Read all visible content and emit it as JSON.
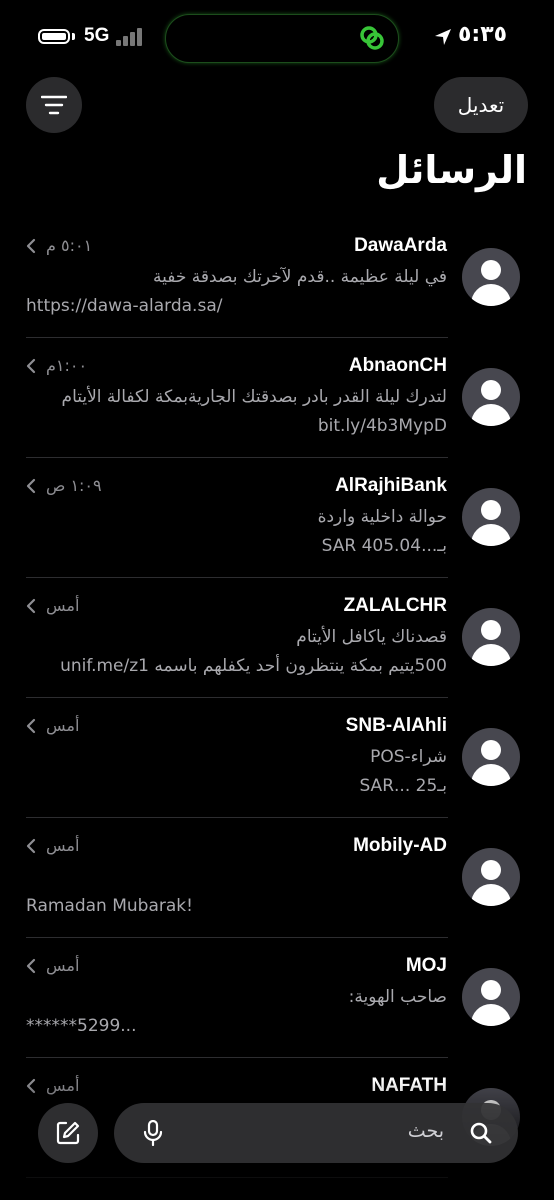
{
  "status_bar": {
    "network": "5G",
    "time": "٥:٣٥",
    "battery_level": 1.0,
    "signal_bars_active": 0
  },
  "header": {
    "edit_label": "تعديل",
    "title": "الرسائل",
    "filter_icon": "filter-lines-icon"
  },
  "messages": [
    {
      "sender": "DawaArda",
      "time": "٥:٠١ م",
      "line1": "في ليلة عظيمة ..قدم لآخرتك بصدقة خفية",
      "line2": "https://dawa-alarda.sa/"
    },
    {
      "sender": "AbnaonCH",
      "time": "١:٠٠م",
      "line1": "لتدرك ليلة القدر بادر بصدقتك الجاريةبمكة لكفالة الأيتام",
      "line2": "bit.ly/4b3MypD"
    },
    {
      "sender": "AlRajhiBank",
      "time": "١:٠٩ ص",
      "line1": "حوالة داخلية واردة",
      "line2": "بـ...SAR 405.04"
    },
    {
      "sender": "ZALALCHR",
      "time": "أمس",
      "line1": "قصدناك ياكافل الأيتام",
      "line2": "500يتيم بمكة ينتظرون أحد يكفلهم باسمه unif.me/z1"
    },
    {
      "sender": "SNB-AlAhli",
      "time": "أمس",
      "line1": "شراء-POS",
      "line2": "بـ25 ...SAR"
    },
    {
      "sender": "Mobily-AD",
      "time": "أمس",
      "line1": "",
      "line2": "Ramadan Mubarak!"
    },
    {
      "sender": "MOJ",
      "time": "أمس",
      "line1": "صاحب الهوية:",
      "line2": "******5299..."
    },
    {
      "sender": "NAFATH",
      "time": "أمس",
      "line1": "",
      "line2": ""
    }
  ],
  "search": {
    "placeholder": "بحث"
  },
  "colors": {
    "background": "#000000",
    "surface": "#2b2b2d",
    "secondary_text": "#a9a9ae",
    "avatar": "#47474f",
    "island_accent": "#38c538"
  }
}
